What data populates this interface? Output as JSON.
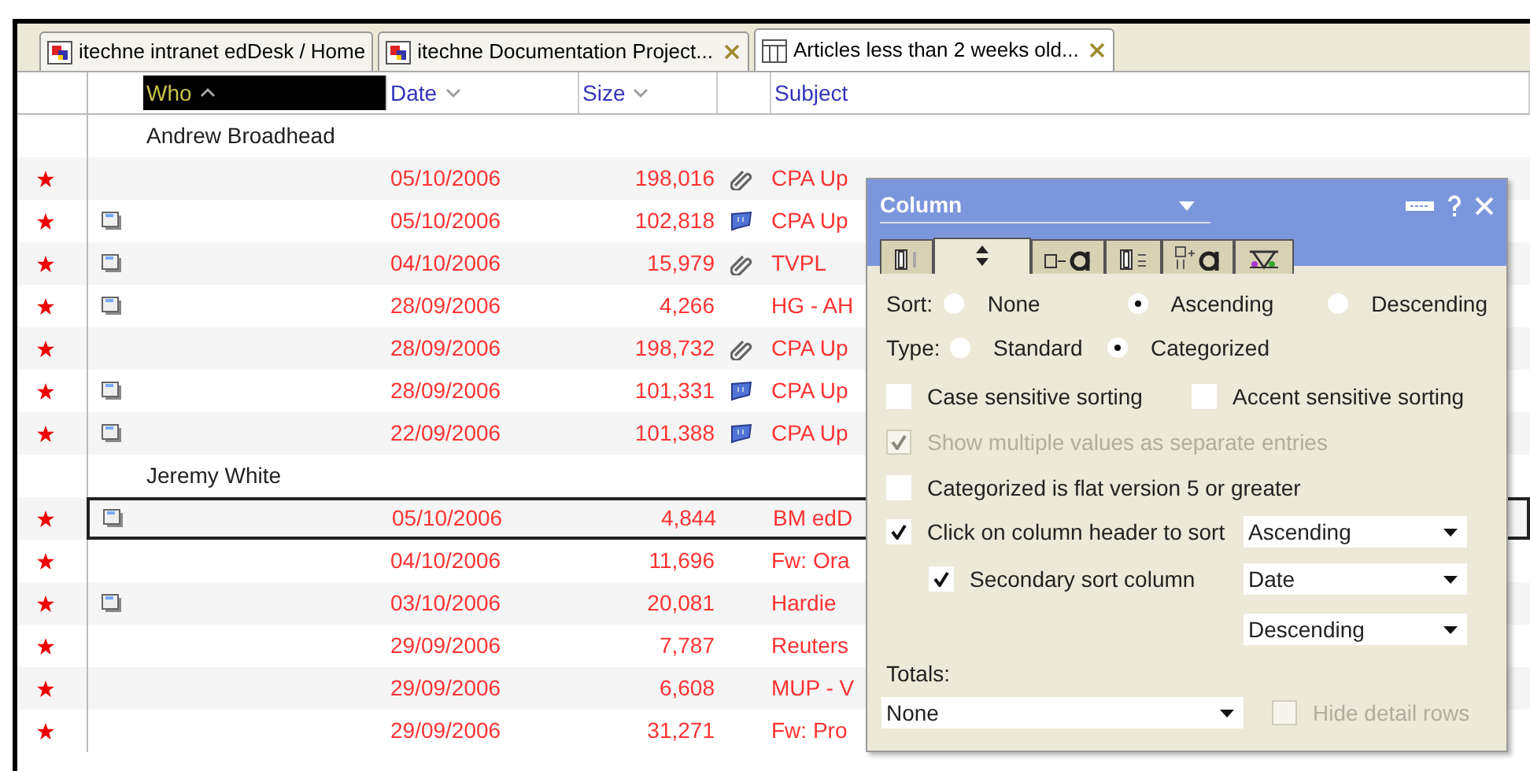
{
  "tabs": [
    {
      "label": "itechne intranet edDesk / Home",
      "kind": "db",
      "closable": false,
      "selected": false
    },
    {
      "label": "itechne Documentation Project...",
      "kind": "db",
      "closable": true,
      "selected": false
    },
    {
      "label": "Articles less than 2 weeks old...",
      "kind": "view",
      "closable": true,
      "selected": true
    }
  ],
  "columns": [
    {
      "label": "Who",
      "sort": {
        "kind": "up"
      },
      "selected": true
    },
    {
      "label": "Date",
      "sort": {
        "kind": "down"
      },
      "selected": false
    },
    {
      "label": "Size",
      "sort": {
        "kind": "down"
      },
      "selected": false
    },
    {
      "label": "Subject",
      "selected": false
    }
  ],
  "groups": [
    {
      "name": "Andrew Broadhead",
      "rows": [
        {
          "unread": true,
          "doc": false,
          "date": "05/10/2006",
          "size": "198,016",
          "attachment": {
            "kind": "clip"
          },
          "subject": "CPA Up",
          "focused": false
        },
        {
          "unread": true,
          "doc": true,
          "date": "05/10/2006",
          "size": "102,818",
          "attachment": {
            "kind": "note"
          },
          "subject": "CPA Up",
          "focused": false
        },
        {
          "unread": true,
          "doc": true,
          "date": "04/10/2006",
          "size": "15,979",
          "attachment": {
            "kind": "clip"
          },
          "subject": "TVPL",
          "focused": false
        },
        {
          "unread": true,
          "doc": true,
          "date": "28/09/2006",
          "size": "4,266",
          "subject": "HG - AH",
          "focused": false
        },
        {
          "unread": true,
          "doc": false,
          "date": "28/09/2006",
          "size": "198,732",
          "attachment": {
            "kind": "clip"
          },
          "subject": "CPA Up",
          "focused": false
        },
        {
          "unread": true,
          "doc": true,
          "date": "28/09/2006",
          "size": "101,331",
          "attachment": {
            "kind": "note"
          },
          "subject": "CPA Up",
          "focused": false
        },
        {
          "unread": true,
          "doc": true,
          "date": "22/09/2006",
          "size": "101,388",
          "attachment": {
            "kind": "note"
          },
          "subject": "CPA Up",
          "focused": false
        }
      ]
    },
    {
      "name": "Jeremy White",
      "rows": [
        {
          "unread": true,
          "doc": true,
          "date": "05/10/2006",
          "size": "4,844",
          "subject": "BM edD",
          "focused": true
        },
        {
          "unread": true,
          "doc": false,
          "date": "04/10/2006",
          "size": "11,696",
          "subject": "Fw: Ora",
          "focused": false
        },
        {
          "unread": true,
          "doc": true,
          "date": "03/10/2006",
          "size": "20,081",
          "subject": "Hardie",
          "focused": false
        },
        {
          "unread": true,
          "doc": false,
          "date": "29/09/2006",
          "size": "7,787",
          "subject": "Reuters",
          "focused": false
        },
        {
          "unread": true,
          "doc": false,
          "date": "29/09/2006",
          "size": "6,608",
          "subject": "MUP - V",
          "focused": false
        },
        {
          "unread": true,
          "doc": false,
          "date": "29/09/2006",
          "size": "31,271",
          "subject": "Fw: Pro",
          "focused": false
        }
      ]
    }
  ],
  "dialog": {
    "title": "Column",
    "tabs": [
      {
        "kind": "basics",
        "selected": false
      },
      {
        "kind": "sorting",
        "selected": true
      },
      {
        "kind": "font",
        "selected": false
      },
      {
        "kind": "numbers",
        "selected": false
      },
      {
        "kind": "title-font",
        "selected": false
      },
      {
        "kind": "advanced",
        "selected": false
      }
    ],
    "sort": {
      "label": "Sort:",
      "options": [
        {
          "label": "None",
          "selected": false
        },
        {
          "label": "Ascending",
          "selected": true
        },
        {
          "label": "Descending",
          "selected": false
        }
      ]
    },
    "type": {
      "label": "Type:",
      "options": [
        {
          "label": "Standard",
          "selected": false
        },
        {
          "label": "Categorized",
          "selected": true
        }
      ]
    },
    "case_sensitive": {
      "label": "Case sensitive sorting",
      "checked": false,
      "disabled": false
    },
    "accent_sensitive": {
      "label": "Accent sensitive sorting",
      "checked": false,
      "disabled": false
    },
    "multiple_values": {
      "label": "Show multiple values as separate entries",
      "checked": true,
      "disabled": true
    },
    "flat_version": {
      "label": "Categorized is flat version 5 or greater",
      "checked": false,
      "disabled": false
    },
    "click_header": {
      "label": "Click on column header to sort",
      "checked": true,
      "disabled": false,
      "value": "Ascending"
    },
    "secondary": {
      "label": "Secondary sort column",
      "checked": true,
      "disabled": false,
      "column": "Date",
      "order": "Descending"
    },
    "totals": {
      "label": "Totals:",
      "value": "None"
    },
    "hide_detail": {
      "label": "Hide detail rows",
      "checked": false,
      "disabled": true
    }
  }
}
